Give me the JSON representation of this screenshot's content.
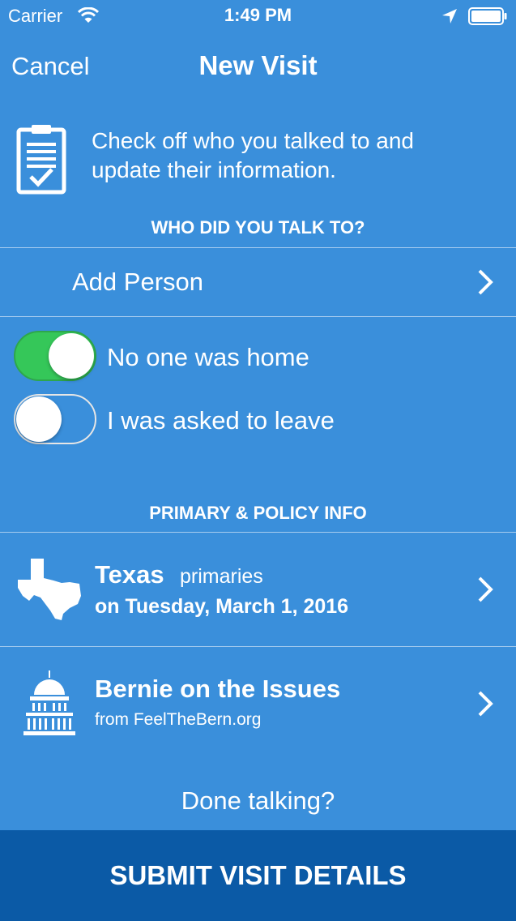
{
  "status_bar": {
    "carrier": "Carrier",
    "time": "1:49 PM",
    "icons": [
      "wifi-icon",
      "location-arrow-icon",
      "battery-icon"
    ]
  },
  "nav": {
    "cancel_label": "Cancel",
    "title": "New Visit"
  },
  "intro": {
    "icon": "clipboard-check-icon",
    "text": "Check off who you talked to and update their information."
  },
  "who_section": {
    "header": "WHO DID YOU TALK TO?",
    "add_person_label": "Add Person",
    "toggles": [
      {
        "label": "No one was home",
        "on": true
      },
      {
        "label": "I was asked to leave",
        "on": false
      }
    ]
  },
  "policy_section": {
    "header": "PRIMARY & POLICY INFO",
    "primary": {
      "icon": "texas-state-icon",
      "state": "Texas",
      "type": "primaries",
      "date": "on Tuesday, March 1, 2016"
    },
    "issues": {
      "icon": "capitol-building-icon",
      "title": "Bernie on the Issues",
      "source": "from FeelTheBern.org"
    }
  },
  "footer": {
    "prompt": "Done talking?",
    "submit_label": "SUBMIT VISIT DETAILS"
  },
  "colors": {
    "background": "#3a8fdb",
    "submit_background": "#0b5aa6",
    "toggle_on": "#35c759"
  }
}
